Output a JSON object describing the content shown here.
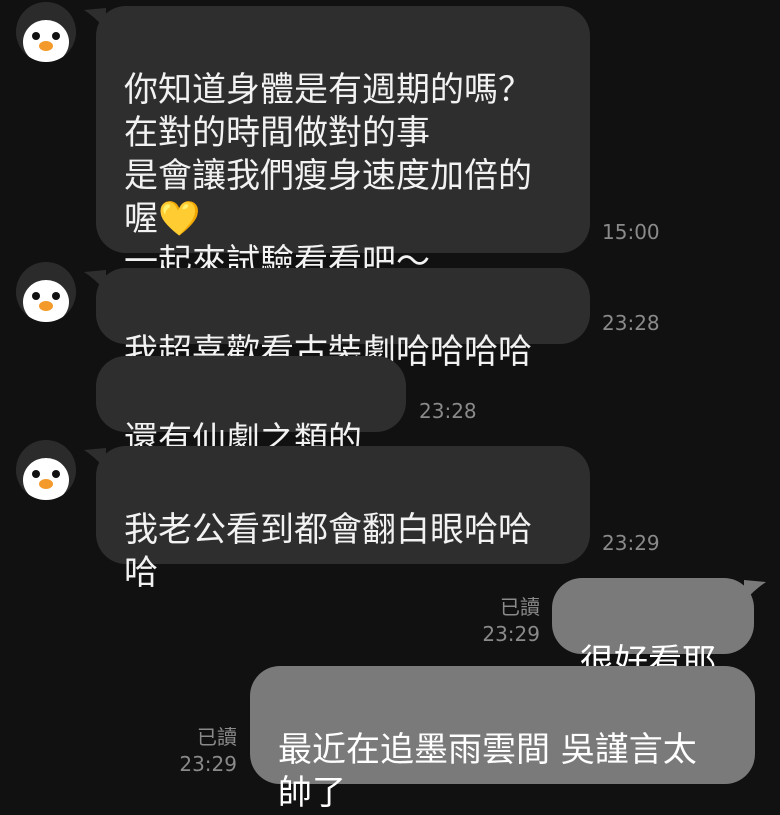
{
  "chat": {
    "messages": [
      {
        "direction": "in",
        "text": "你知道身體是有週期的嗎？\n在對的時間做對的事\n是會讓我們瘦身速度加倍的\n喔💛\n一起來試驗看看吧～",
        "time": "15:00"
      },
      {
        "direction": "in",
        "text": "我超喜歡看古裝劇哈哈哈哈",
        "time": "23:28"
      },
      {
        "direction": "in",
        "text": "還有仙劇之類的",
        "time": "23:28"
      },
      {
        "direction": "in",
        "text": "我老公看到都會翻白眼哈哈\n哈",
        "time": "23:29"
      },
      {
        "direction": "out",
        "text": "很好看耶",
        "read": "已讀",
        "time": "23:29"
      },
      {
        "direction": "out",
        "text": "最近在追墨雨雲間 吳謹言太\n帥了",
        "read": "已讀",
        "time": "23:29"
      }
    ]
  },
  "colors": {
    "background": "#111111",
    "incoming_bubble": "#2e2e2e",
    "outgoing_bubble": "#7a7a7a",
    "meta_text": "#8a8a8a"
  },
  "icons": {
    "avatar": "penguin-avatar-icon"
  }
}
